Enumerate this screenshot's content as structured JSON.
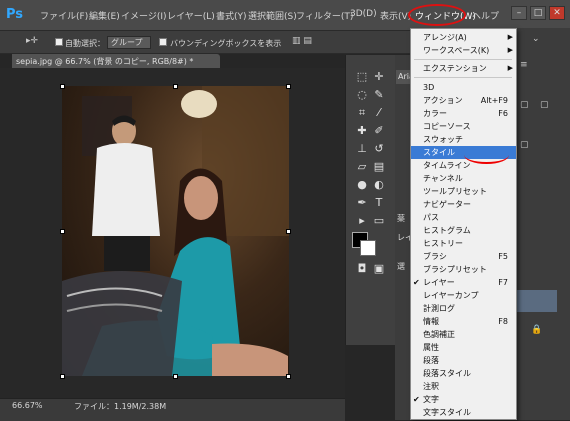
{
  "menubar": {
    "logo": "Ps",
    "items": [
      "ファイル(F)",
      "編集(E)",
      "イメージ(I)",
      "レイヤー(L)",
      "書式(Y)",
      "選択範囲(S)",
      "フィルター(T)",
      "3D(D)",
      "表示(V)"
    ],
    "window": "ウィンドウ(W)",
    "help": "ヘルプ"
  },
  "window_controls": {
    "minimize": "–",
    "maximize": "□",
    "close": "✕"
  },
  "options": {
    "auto_select": "自動選択：",
    "group": "グループ",
    "bounding_box": "バウンディングボックスを表示"
  },
  "document": {
    "tab_title": "sepia.jpg @ 66.7% (背景 のコピー, RGB/8#) *",
    "tab_close": "×"
  },
  "status": {
    "zoom": "66.67%",
    "file": "ファイル：1.19M/2.38M"
  },
  "right_panel": {
    "tab_label": "Aria",
    "label_a": "薬",
    "label_b": "レイ",
    "label_c": "選"
  },
  "dropdown": {
    "items": [
      {
        "label": "アレンジ(A)",
        "submenu": true
      },
      {
        "label": "ワークスペース(K)",
        "submenu": true
      },
      {
        "sep": true
      },
      {
        "label": "エクステンション",
        "submenu": true
      },
      {
        "sep": true
      },
      {
        "label": "3D"
      },
      {
        "label": "アクション",
        "shortcut": "Alt+F9"
      },
      {
        "label": "カラー",
        "shortcut": "F6"
      },
      {
        "label": "コピーソース"
      },
      {
        "label": "スウォッチ"
      },
      {
        "label": "スタイル",
        "highlight": true
      },
      {
        "label": "タイムライン"
      },
      {
        "label": "チャンネル"
      },
      {
        "label": "ツールプリセット"
      },
      {
        "label": "ナビゲーター"
      },
      {
        "label": "パス"
      },
      {
        "label": "ヒストグラム"
      },
      {
        "label": "ヒストリー"
      },
      {
        "label": "ブラシ",
        "shortcut": "F5"
      },
      {
        "label": "ブラシプリセット"
      },
      {
        "label": "レイヤー",
        "shortcut": "F7",
        "checked": true
      },
      {
        "label": "レイヤーカンプ"
      },
      {
        "label": "計測ログ"
      },
      {
        "label": "情報",
        "shortcut": "F8"
      },
      {
        "label": "色調補正"
      },
      {
        "label": "属性"
      },
      {
        "label": "段落"
      },
      {
        "label": "段落スタイル"
      },
      {
        "label": "注釈"
      },
      {
        "label": "文字",
        "checked": true
      },
      {
        "label": "文字スタイル"
      }
    ]
  },
  "colors": {
    "accent": "#3a7bd5",
    "annotation_red": "#e00000",
    "ps_blue": "#31a8ff"
  }
}
